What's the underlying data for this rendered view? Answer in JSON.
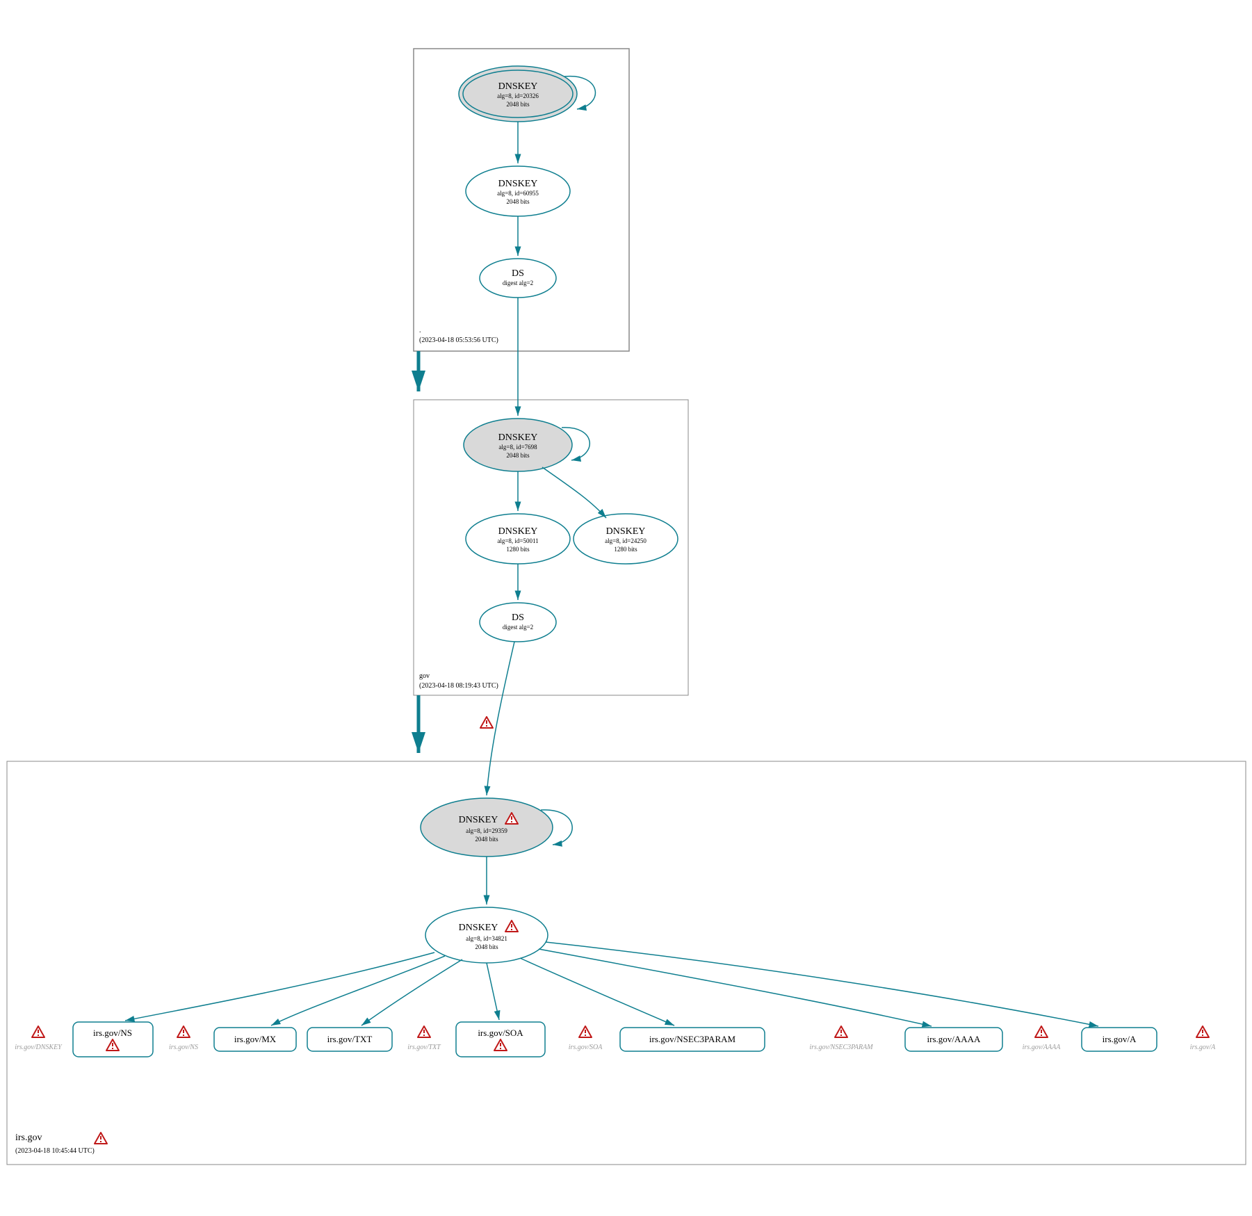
{
  "zones": {
    "root": {
      "name": ".",
      "timestamp": "(2023-04-18 05:53:56 UTC)"
    },
    "gov": {
      "name": "gov",
      "timestamp": "(2023-04-18 08:19:43 UTC)"
    },
    "irs": {
      "name": "irs.gov",
      "timestamp": "(2023-04-18 10:45:44 UTC)"
    }
  },
  "nodes": {
    "root_ksk": {
      "title": "DNSKEY",
      "sub1": "alg=8, id=20326",
      "sub2": "2048 bits"
    },
    "root_zsk": {
      "title": "DNSKEY",
      "sub1": "alg=8, id=60955",
      "sub2": "2048 bits"
    },
    "root_ds": {
      "title": "DS",
      "sub1": "digest alg=2"
    },
    "gov_ksk": {
      "title": "DNSKEY",
      "sub1": "alg=8, id=7698",
      "sub2": "2048 bits"
    },
    "gov_zsk1": {
      "title": "DNSKEY",
      "sub1": "alg=8, id=50011",
      "sub2": "1280 bits"
    },
    "gov_zsk2": {
      "title": "DNSKEY",
      "sub1": "alg=8, id=24250",
      "sub2": "1280 bits"
    },
    "gov_ds": {
      "title": "DS",
      "sub1": "digest alg=2"
    },
    "irs_ksk": {
      "title": "DNSKEY",
      "sub1": "alg=8, id=29359",
      "sub2": "2048 bits"
    },
    "irs_zsk": {
      "title": "DNSKEY",
      "sub1": "alg=8, id=34821",
      "sub2": "2048 bits"
    }
  },
  "rrsets": {
    "ns": "irs.gov/NS",
    "mx": "irs.gov/MX",
    "txt": "irs.gov/TXT",
    "soa": "irs.gov/SOA",
    "nsec3": "irs.gov/NSEC3PARAM",
    "aaaa": "irs.gov/AAAA",
    "a": "irs.gov/A"
  },
  "grey_labels": {
    "dnskey": "irs.gov/DNSKEY",
    "ns": "irs.gov/NS",
    "txt": "irs.gov/TXT",
    "soa": "irs.gov/SOA",
    "nsec3": "irs.gov/NSEC3PARAM",
    "aaaa": "irs.gov/AAAA",
    "a": "irs.gov/A"
  }
}
